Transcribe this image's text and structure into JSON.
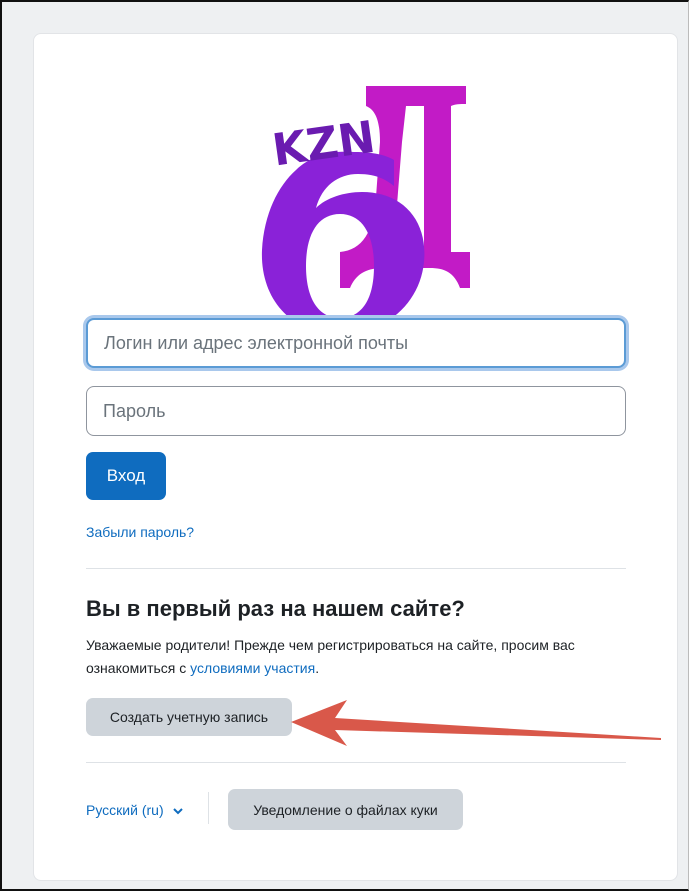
{
  "form": {
    "username_placeholder": "Логин или адрес электронной почты",
    "password_placeholder": "Пароль",
    "login_button": "Вход",
    "forgot_password": "Забыли пароль?"
  },
  "signup": {
    "heading": "Вы в первый раз на нашем сайте?",
    "description_prefix": "Уважаемые родители! Прежде чем регистрироваться на сайте, просим вас ознакомиться с",
    "terms_link": "условиями участия",
    "description_suffix": ".",
    "create_account_button": "Создать учетную запись"
  },
  "footer": {
    "language": "Русский (ru)",
    "cookie_notice_button": "Уведомление о файлах куки"
  },
  "logo": {
    "text": "KZN",
    "colors": {
      "text": "#6a1bb0",
      "violet": "#8a22d8",
      "magenta": "#c21bc6"
    }
  },
  "annotation": {
    "arrow_color": "#d9584a"
  },
  "colors": {
    "primary": "#0f6cbf",
    "secondary": "#ced4da",
    "focus_ring": "#5b9bd5"
  }
}
